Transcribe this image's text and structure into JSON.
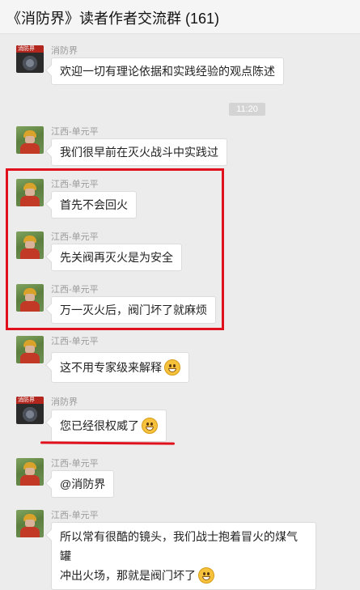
{
  "header": {
    "title": "《消防界》读者作者交流群 (161)"
  },
  "avatars": {
    "truck_band_text": "消防界"
  },
  "timestamp": "11:20",
  "messages": [
    {
      "sender": "消防界",
      "avatar": "truck",
      "text": "欢迎一切有理论依据和实践经验的观点陈述"
    },
    {
      "sender": "江西-单元平",
      "avatar": "firefighter",
      "text": "我们很早前在灭火战斗中实践过"
    },
    {
      "sender": "江西-单元平",
      "avatar": "firefighter",
      "text": "首先不会回火"
    },
    {
      "sender": "江西-单元平",
      "avatar": "firefighter",
      "text": "先关阀再灭火是为安全"
    },
    {
      "sender": "江西-单元平",
      "avatar": "firefighter",
      "text": "万一灭火后，阀门坏了就麻烦"
    },
    {
      "sender": "江西-单元平",
      "avatar": "firefighter",
      "text": "这不用专家级来解释",
      "emoji": "grin-emoji"
    },
    {
      "sender": "消防界",
      "avatar": "truck",
      "text": "您已经很权威了",
      "emoji": "grin-emoji"
    },
    {
      "sender": "江西-单元平",
      "avatar": "firefighter",
      "text": "@消防界"
    },
    {
      "sender": "江西-单元平",
      "avatar": "firefighter",
      "text_line1": "所以常有很酷的镜头，我们战士抱着冒火的煤气罐",
      "text_line2": "冲出火场，那就是阀门坏了",
      "emoji": "laugh-emoji"
    }
  ],
  "annotations": {
    "highlight_color": "#e0101c"
  }
}
